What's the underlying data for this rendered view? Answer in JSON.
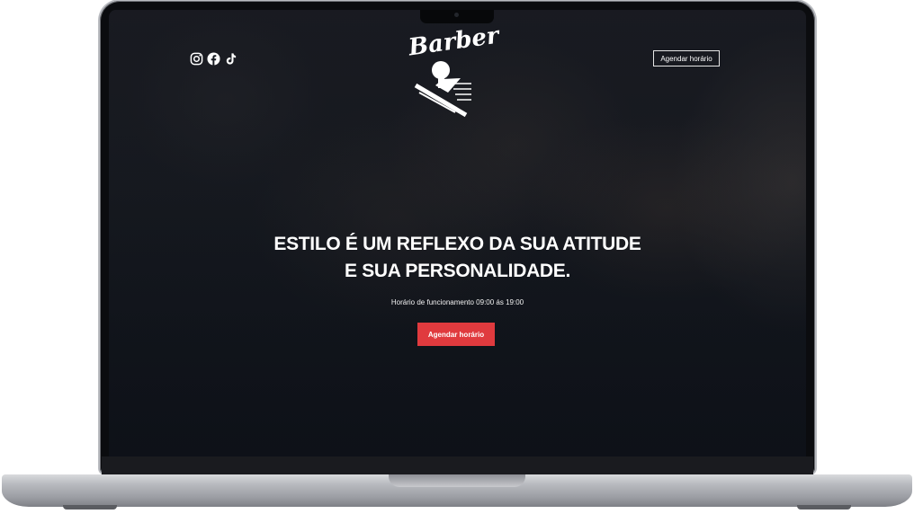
{
  "header": {
    "social_icons": [
      "instagram-icon",
      "facebook-icon",
      "tiktok-icon"
    ],
    "logo_text": "Barber",
    "nav_button_label": "Agendar horário"
  },
  "hero": {
    "headline_line1": "ESTILO É UM REFLEXO DA SUA ATITUDE",
    "headline_line2": "E SUA PERSONALIDADE.",
    "hours_text": "Horário de funcionamento 09:00 ás 19:00",
    "cta_label": "Agendar horário"
  },
  "colors": {
    "accent": "#e03a3e",
    "text": "#ffffff",
    "background": "#161a21"
  }
}
